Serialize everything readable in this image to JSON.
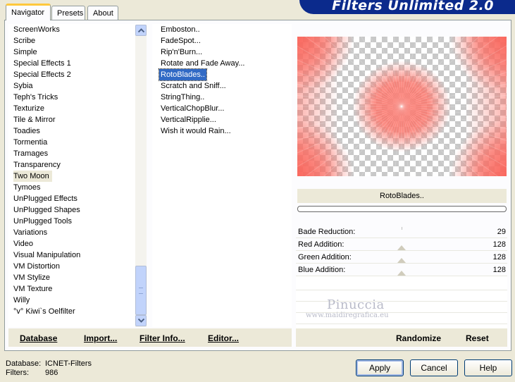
{
  "tabs": {
    "navigator": "Navigator",
    "presets": "Presets",
    "about": "About"
  },
  "brand": "Filters Unlimited 2.0",
  "categories": [
    "ScreenWorks",
    "Scribe",
    "Simple",
    "Special Effects 1",
    "Special Effects 2",
    "Sybia",
    "Teph's Tricks",
    "Texturize",
    "Tile & Mirror",
    "Toadies",
    "Tormentia",
    "Tramages",
    "Transparency",
    "Two Moon",
    "Tymoes",
    "UnPlugged Effects",
    "UnPlugged Shapes",
    "UnPlugged Tools",
    "Variations",
    "Video",
    "Visual Manipulation",
    "VM Distortion",
    "VM Stylize",
    "VM Texture",
    "Willy",
    "°v° Kiwi`s Oelfilter"
  ],
  "selected_category": "Two Moon",
  "filters": [
    "Emboston..",
    "FadeSpot...",
    "Rip'n'Burn...",
    "Rotate and Fade Away...",
    "RotoBlades..",
    "Scratch and Sniff...",
    "StringThing..",
    "VerticalChopBlur...",
    "VerticalRipplie...",
    "Wish it would Rain..."
  ],
  "selected_filter": "RotoBlades..",
  "left_buttons": {
    "database": "Database",
    "import": "Import...",
    "filter_info": "Filter Info...",
    "editor": "Editor..."
  },
  "filter_name": "RotoBlades..",
  "params": [
    {
      "name": "Bade Reduction:",
      "value": "29"
    },
    {
      "name": "Red Addition:",
      "value": "128"
    },
    {
      "name": "Green Addition:",
      "value": "128"
    },
    {
      "name": "Blue Addition:",
      "value": "128"
    }
  ],
  "watermark": {
    "name": "Pinuccia",
    "url": "www.maidiregrafica.eu"
  },
  "right_buttons": {
    "randomize": "Randomize",
    "reset": "Reset"
  },
  "footer": {
    "database_label": "Database:",
    "database_value": "ICNET-Filters",
    "filters_label": "Filters:",
    "filters_value": "986"
  },
  "dialog_buttons": {
    "apply": "Apply",
    "cancel": "Cancel",
    "help": "Help"
  },
  "colors": {
    "accent": "#316ac5",
    "brand_bg": "#0b2a8c",
    "preview_tint": "#fa6e64"
  }
}
